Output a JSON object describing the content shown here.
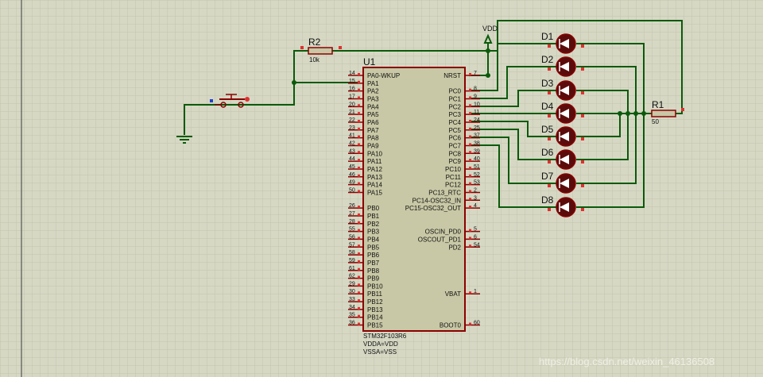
{
  "chip": {
    "ref": "U1",
    "part": "STM32F103R6",
    "notes": [
      "VDDA=VDD",
      "VSSA=VSS"
    ],
    "left_pins": [
      {
        "num": "14",
        "label": "PA0-WKUP"
      },
      {
        "num": "15",
        "label": "PA1"
      },
      {
        "num": "16",
        "label": "PA2"
      },
      {
        "num": "17",
        "label": "PA3"
      },
      {
        "num": "20",
        "label": "PA4"
      },
      {
        "num": "21",
        "label": "PA5"
      },
      {
        "num": "22",
        "label": "PA6"
      },
      {
        "num": "23",
        "label": "PA7"
      },
      {
        "num": "41",
        "label": "PA8"
      },
      {
        "num": "42",
        "label": "PA9"
      },
      {
        "num": "43",
        "label": "PA10"
      },
      {
        "num": "44",
        "label": "PA11"
      },
      {
        "num": "45",
        "label": "PA12"
      },
      {
        "num": "46",
        "label": "PA13"
      },
      {
        "num": "49",
        "label": "PA14"
      },
      {
        "num": "50",
        "label": "PA15"
      },
      {
        "num": "",
        "label": ""
      },
      {
        "num": "26",
        "label": "PB0"
      },
      {
        "num": "27",
        "label": "PB1"
      },
      {
        "num": "28",
        "label": "PB2"
      },
      {
        "num": "55",
        "label": "PB3"
      },
      {
        "num": "56",
        "label": "PB4"
      },
      {
        "num": "57",
        "label": "PB5"
      },
      {
        "num": "58",
        "label": "PB6"
      },
      {
        "num": "59",
        "label": "PB7"
      },
      {
        "num": "61",
        "label": "PB8"
      },
      {
        "num": "62",
        "label": "PB9"
      },
      {
        "num": "29",
        "label": "PB10"
      },
      {
        "num": "30",
        "label": "PB11"
      },
      {
        "num": "33",
        "label": "PB12"
      },
      {
        "num": "34",
        "label": "PB13"
      },
      {
        "num": "35",
        "label": "PB14"
      },
      {
        "num": "36",
        "label": "PB15"
      }
    ],
    "right_pins": [
      {
        "num": "7",
        "label": "NRST"
      },
      {
        "num": "",
        "label": ""
      },
      {
        "num": "8",
        "label": "PC0"
      },
      {
        "num": "9",
        "label": "PC1"
      },
      {
        "num": "10",
        "label": "PC2"
      },
      {
        "num": "11",
        "label": "PC3"
      },
      {
        "num": "24",
        "label": "PC4"
      },
      {
        "num": "25",
        "label": "PC5"
      },
      {
        "num": "37",
        "label": "PC6"
      },
      {
        "num": "38",
        "label": "PC7"
      },
      {
        "num": "39",
        "label": "PC8"
      },
      {
        "num": "40",
        "label": "PC9"
      },
      {
        "num": "51",
        "label": "PC10"
      },
      {
        "num": "52",
        "label": "PC11"
      },
      {
        "num": "53",
        "label": "PC12"
      },
      {
        "num": "2",
        "label": "PC13_RTC"
      },
      {
        "num": "3",
        "label": "PC14-OSC32_IN"
      },
      {
        "num": "4",
        "label": "PC15-OSC32_OUT"
      },
      {
        "num": "",
        "label": ""
      },
      {
        "num": "",
        "label": ""
      },
      {
        "num": "5",
        "label": "OSCIN_PD0"
      },
      {
        "num": "6",
        "label": "OSCOUT_PD1"
      },
      {
        "num": "54",
        "label": "PD2"
      },
      {
        "num": "",
        "label": ""
      },
      {
        "num": "",
        "label": ""
      },
      {
        "num": "",
        "label": ""
      },
      {
        "num": "",
        "label": ""
      },
      {
        "num": "",
        "label": ""
      },
      {
        "num": "1",
        "label": "VBAT"
      },
      {
        "num": "",
        "label": ""
      },
      {
        "num": "",
        "label": ""
      },
      {
        "num": "",
        "label": ""
      },
      {
        "num": "60",
        "label": "BOOT0"
      }
    ]
  },
  "resistors": [
    {
      "ref": "R2",
      "value": "10k"
    },
    {
      "ref": "R1",
      "value": "50"
    }
  ],
  "leds": [
    "D1",
    "D2",
    "D3",
    "D4",
    "D5",
    "D6",
    "D7",
    "D8"
  ],
  "power": {
    "vdd": "VDD"
  },
  "watermark": "https://blog.csdn.net/weixin_46136508",
  "colors": {
    "background": "#d6d8c4",
    "grid": "#c2c4ad",
    "wire": "#0a5a0a",
    "component": "#8b0000",
    "chip_fill": "#c8c8a6",
    "led_fill": "#5c0b0b",
    "pin_marker": "#e03030",
    "text": "#101010"
  }
}
